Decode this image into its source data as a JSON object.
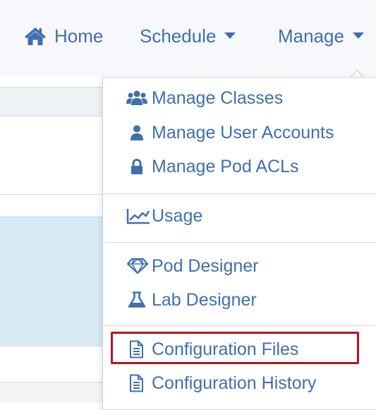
{
  "nav": {
    "home_label": "Home",
    "schedule_label": "Schedule",
    "manage_label": "Manage"
  },
  "manage_menu": {
    "items": [
      {
        "label": "Manage Classes",
        "icon": "users-icon"
      },
      {
        "label": "Manage User Accounts",
        "icon": "user-icon"
      },
      {
        "label": "Manage Pod ACLs",
        "icon": "lock-icon"
      },
      {
        "label": "Usage",
        "icon": "line-chart-icon"
      },
      {
        "label": "Pod Designer",
        "icon": "diamond-icon"
      },
      {
        "label": "Lab Designer",
        "icon": "flask-icon"
      },
      {
        "label": "Configuration Files",
        "icon": "file-text-icon"
      },
      {
        "label": "Configuration History",
        "icon": "file-text-icon"
      }
    ],
    "highlighted_item": "Configuration Files"
  },
  "colors": {
    "link": "#3f6fae",
    "highlight_border": "#b3141f",
    "selected_row_bg": "#d9ebf6"
  }
}
